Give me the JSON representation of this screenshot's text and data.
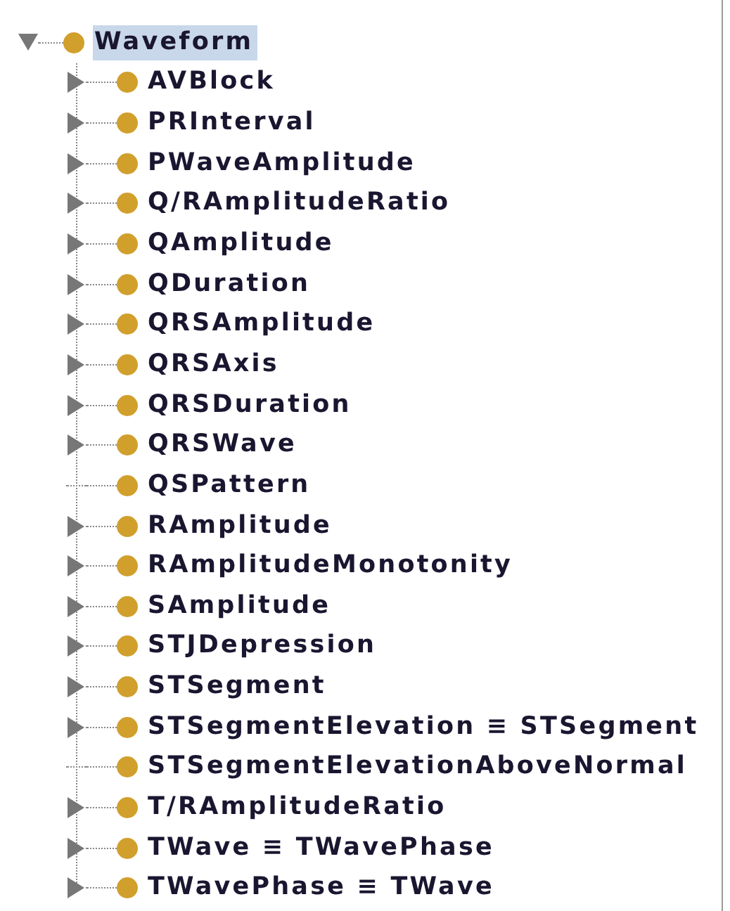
{
  "tree": {
    "label": "Waveform",
    "expanded": true,
    "selected": true,
    "children": [
      {
        "label": "AVBlock",
        "has_children": true,
        "selected": false
      },
      {
        "label": "PRInterval",
        "has_children": true,
        "selected": false
      },
      {
        "label": "PWaveAmplitude",
        "has_children": true,
        "selected": false
      },
      {
        "label": "Q/RAmplitudeRatio",
        "has_children": true,
        "selected": false
      },
      {
        "label": "QAmplitude",
        "has_children": true,
        "selected": false
      },
      {
        "label": "QDuration",
        "has_children": true,
        "selected": false
      },
      {
        "label": "QRSAmplitude",
        "has_children": true,
        "selected": false
      },
      {
        "label": "QRSAxis",
        "has_children": true,
        "selected": false
      },
      {
        "label": "QRSDuration",
        "has_children": true,
        "selected": false
      },
      {
        "label": "QRSWave",
        "has_children": true,
        "selected": false
      },
      {
        "label": "QSPattern",
        "has_children": false,
        "selected": false
      },
      {
        "label": "RAmplitude",
        "has_children": true,
        "selected": false
      },
      {
        "label": "RAmplitudeMonotonity",
        "has_children": true,
        "selected": false
      },
      {
        "label": "SAmplitude",
        "has_children": true,
        "selected": false
      },
      {
        "label": "STJDepression",
        "has_children": true,
        "selected": false
      },
      {
        "label": "STSegment",
        "has_children": true,
        "selected": false
      },
      {
        "label": "STSegmentElevation ≡ STSegment",
        "has_children": true,
        "selected": false
      },
      {
        "label": "STSegmentElevationAboveNormal",
        "has_children": false,
        "selected": false
      },
      {
        "label": "T/RAmplitudeRatio",
        "has_children": true,
        "selected": false
      },
      {
        "label": "TWave ≡ TWavePhase",
        "has_children": true,
        "selected": false
      },
      {
        "label": "TWavePhase ≡ TWave",
        "has_children": true,
        "selected": false
      }
    ]
  }
}
